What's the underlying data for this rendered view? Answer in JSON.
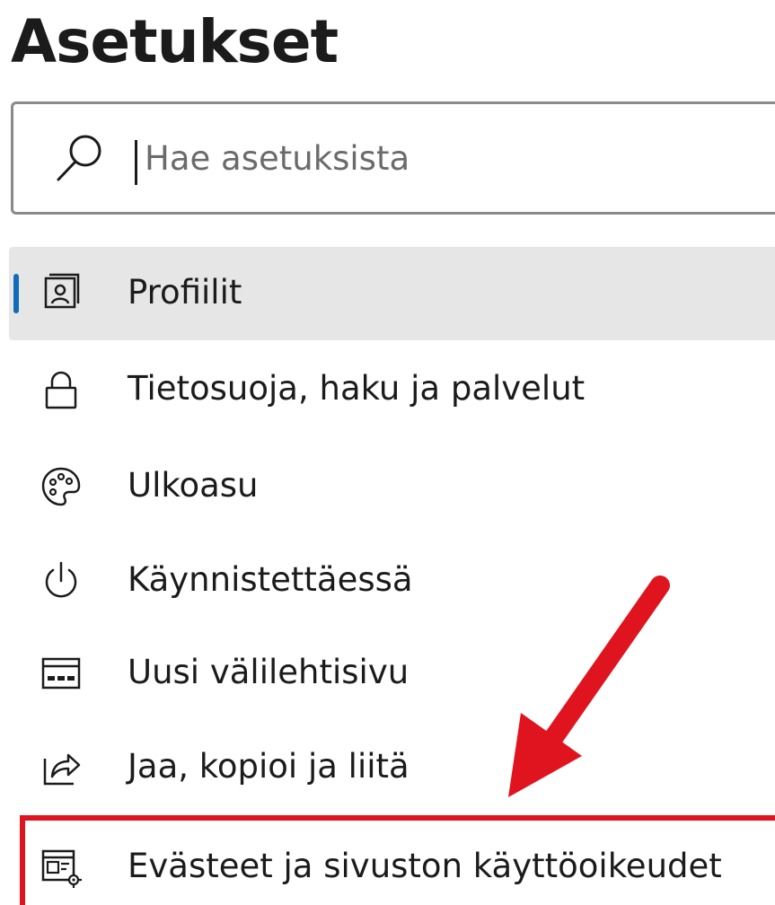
{
  "header": {
    "title": "Asetukset"
  },
  "search": {
    "placeholder": "Hae asetuksista",
    "value": "",
    "icon": "search-icon"
  },
  "sidebar": {
    "items": [
      {
        "label": "Profiilit",
        "icon": "profile-icon",
        "selected": true
      },
      {
        "label": "Tietosuoja, haku ja palvelut",
        "icon": "lock-icon",
        "selected": false
      },
      {
        "label": "Ulkoasu",
        "icon": "palette-icon",
        "selected": false
      },
      {
        "label": "Käynnistettäessä",
        "icon": "power-icon",
        "selected": false
      },
      {
        "label": "Uusi välilehtisivu",
        "icon": "new-tab-icon",
        "selected": false
      },
      {
        "label": "Jaa, kopioi ja liitä",
        "icon": "share-icon",
        "selected": false
      },
      {
        "label": "Evästeet ja sivuston käyttöoikeudet",
        "icon": "site-permissions-icon",
        "selected": false
      }
    ]
  },
  "colors": {
    "accent": "#0f6cbd",
    "annotation": "#e0141e",
    "selected_background": "#e6e6e6"
  }
}
